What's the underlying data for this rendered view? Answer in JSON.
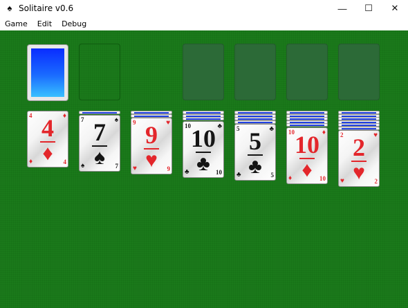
{
  "window": {
    "title": "Solitaire v0.6",
    "app_icon": "spade-icon",
    "controls": {
      "minimize": "—",
      "maximize": "☐",
      "close": "✕"
    }
  },
  "menu": [
    "Game",
    "Edit",
    "Debug"
  ],
  "colors": {
    "felt": "#1a7a1a",
    "red_suit": "#e3262b",
    "black_suit": "#151515",
    "card_back": "#1f3fe0"
  },
  "stock": {
    "face": "down",
    "back": "blue-gradient"
  },
  "waste": {
    "cards": []
  },
  "foundations": [
    {
      "cards": []
    },
    {
      "cards": []
    },
    {
      "cards": []
    },
    {
      "cards": []
    }
  ],
  "tableau": [
    {
      "hidden": 0,
      "face_up": {
        "rank": "4",
        "suit": "♦",
        "color": "red"
      }
    },
    {
      "hidden": 1,
      "face_up": {
        "rank": "7",
        "suit": "♠",
        "color": "black"
      }
    },
    {
      "hidden": 2,
      "face_up": {
        "rank": "9",
        "suit": "♥",
        "color": "red"
      }
    },
    {
      "hidden": 3,
      "face_up": {
        "rank": "10",
        "suit": "♣",
        "color": "black"
      }
    },
    {
      "hidden": 4,
      "face_up": {
        "rank": "5",
        "suit": "♣",
        "color": "black"
      }
    },
    {
      "hidden": 5,
      "face_up": {
        "rank": "10",
        "suit": "♦",
        "color": "red"
      }
    },
    {
      "hidden": 6,
      "face_up": {
        "rank": "2",
        "suit": "♥",
        "color": "red"
      }
    }
  ]
}
